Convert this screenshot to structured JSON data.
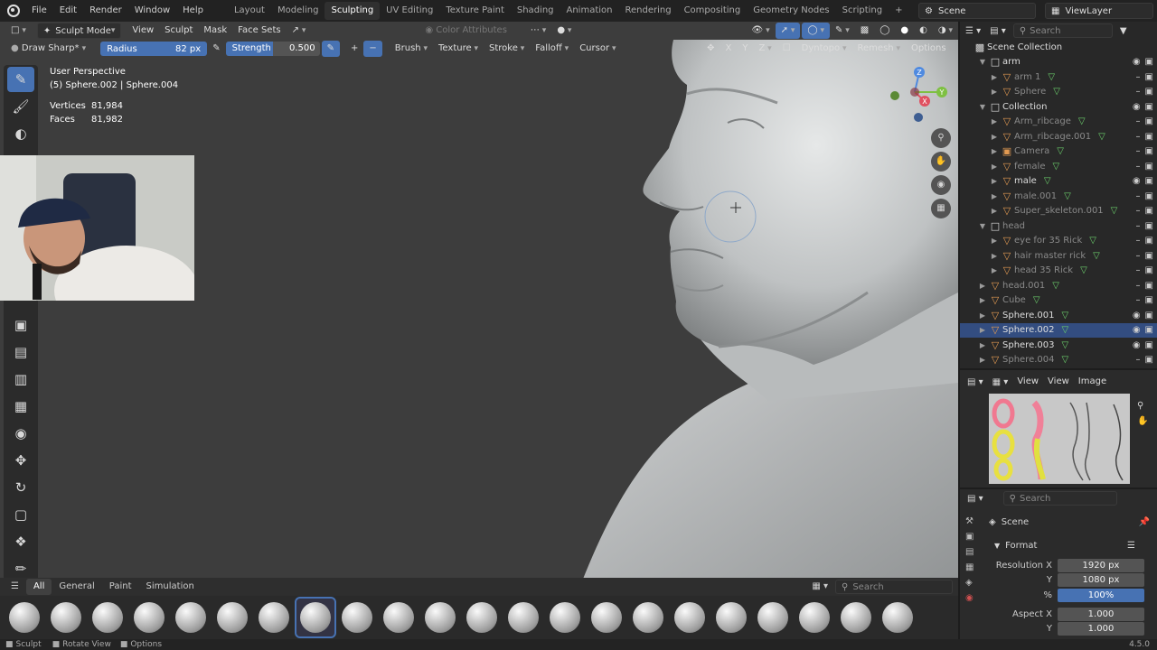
{
  "menu": {
    "items": [
      "File",
      "Edit",
      "Render",
      "Window",
      "Help"
    ],
    "workspaces": [
      "Layout",
      "Modeling",
      "Sculpting",
      "UV Editing",
      "Texture Paint",
      "Shading",
      "Animation",
      "Rendering",
      "Compositing",
      "Geometry Nodes",
      "Scripting"
    ],
    "active_workspace": "Sculpting",
    "scene": "Scene",
    "view_layer": "ViewLayer"
  },
  "viewport_header": {
    "mode": "Sculpt Mode",
    "menus": [
      "View",
      "Sculpt",
      "Mask",
      "Face Sets"
    ],
    "color_attributes": "Color Attributes"
  },
  "tool_header": {
    "brush": "Draw Sharp*",
    "radius_label": "Radius",
    "radius_value": "82 px",
    "strength_label": "Strength",
    "strength_value": "0.500",
    "menus": [
      "Brush",
      "Texture",
      "Stroke",
      "Falloff",
      "Cursor"
    ],
    "axes": [
      "X",
      "Y",
      "Z"
    ],
    "dyntopo": "Dyntopo",
    "remesh": "Remesh",
    "options": "Options"
  },
  "overlay_info": {
    "view": "User Perspective",
    "object": "(5) Sphere.002 | Sphere.004",
    "vertices_label": "Vertices",
    "vertices": "81,984",
    "faces_label": "Faces",
    "faces": "81,982"
  },
  "bottom_tabs": [
    "All",
    "General",
    "Paint",
    "Simulation"
  ],
  "bottom_search": "Search",
  "outliner": {
    "search": "Search",
    "title": "Scene Collection",
    "rows": [
      {
        "label": "arm",
        "kind": "collection",
        "indent": 1,
        "dim": false
      },
      {
        "label": "arm 1",
        "kind": "mesh",
        "indent": 2,
        "dim": true
      },
      {
        "label": "Sphere",
        "kind": "mesh",
        "indent": 2,
        "dim": true
      },
      {
        "label": "Collection",
        "kind": "collection",
        "indent": 1,
        "dim": false
      },
      {
        "label": "Arm_ribcage",
        "kind": "mesh",
        "indent": 2,
        "dim": true
      },
      {
        "label": "Arm_ribcage.001",
        "kind": "mesh",
        "indent": 2,
        "dim": true
      },
      {
        "label": "Camera",
        "kind": "camera",
        "indent": 2,
        "dim": true
      },
      {
        "label": "female",
        "kind": "mesh",
        "indent": 2,
        "dim": true
      },
      {
        "label": "male",
        "kind": "mesh",
        "indent": 2,
        "dim": false
      },
      {
        "label": "male.001",
        "kind": "mesh",
        "indent": 2,
        "dim": true
      },
      {
        "label": "Super_skeleton.001",
        "kind": "mesh",
        "indent": 2,
        "dim": true
      },
      {
        "label": "head",
        "kind": "collection",
        "indent": 1,
        "dim": true
      },
      {
        "label": "eye for 35 Rick",
        "kind": "mesh",
        "indent": 2,
        "dim": true
      },
      {
        "label": "hair master rick",
        "kind": "mesh",
        "indent": 2,
        "dim": true
      },
      {
        "label": "head 35 Rick",
        "kind": "mesh",
        "indent": 2,
        "dim": true
      },
      {
        "label": "head.001",
        "kind": "mesh",
        "indent": 1,
        "dim": true
      },
      {
        "label": "Cube",
        "kind": "mesh",
        "indent": 1,
        "dim": true
      },
      {
        "label": "Sphere.001",
        "kind": "mesh",
        "indent": 1,
        "dim": false
      },
      {
        "label": "Sphere.002",
        "kind": "mesh",
        "indent": 1,
        "dim": false,
        "selected": true
      },
      {
        "label": "Sphere.003",
        "kind": "mesh",
        "indent": 1,
        "dim": false
      },
      {
        "label": "Sphere.004",
        "kind": "mesh",
        "indent": 1,
        "dim": true
      }
    ]
  },
  "image_editor": {
    "view": "View",
    "view2": "View",
    "image": "Image"
  },
  "properties": {
    "search": "Search",
    "scene": "Scene",
    "panel": "Format",
    "rows": [
      {
        "label": "Resolution X",
        "value": "1920 px",
        "highlight": false
      },
      {
        "label": "Y",
        "value": "1080 px",
        "highlight": false
      },
      {
        "label": "%",
        "value": "100%",
        "highlight": true
      },
      {
        "label": "Aspect X",
        "value": "1.000",
        "highlight": false
      },
      {
        "label": "Y",
        "value": "1.000",
        "highlight": false
      }
    ]
  },
  "statusbar": {
    "items": [
      "Sculpt",
      "Rotate View",
      "Options"
    ],
    "version": "4.5.0"
  }
}
